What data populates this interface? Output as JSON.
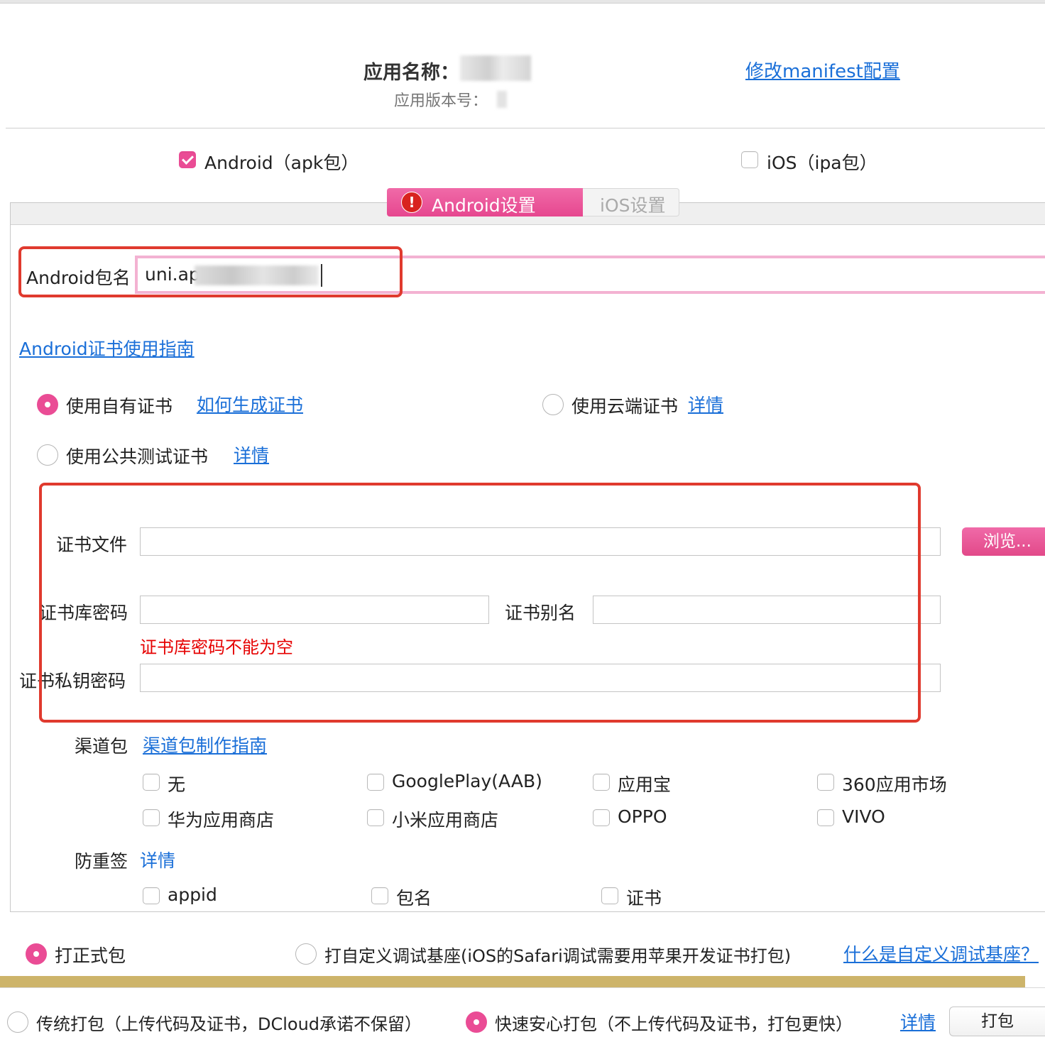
{
  "header": {
    "app_name_label": "应用名称：",
    "version_label": "应用版本号：",
    "manifest_link": "修改manifest配置"
  },
  "platforms": {
    "android": {
      "label": "Android（apk包）",
      "checked": true
    },
    "ios": {
      "label": "iOS（ipa包）",
      "checked": false
    }
  },
  "tabs": [
    {
      "label": "Android设置",
      "active": true,
      "warning": true
    },
    {
      "label": "iOS设置",
      "active": false
    }
  ],
  "package": {
    "label": "Android包名",
    "value": "uni.ap"
  },
  "cert_guide_link": "Android证书使用指南",
  "cert_options": {
    "own": {
      "label": "使用自有证书",
      "link": "如何生成证书",
      "checked": true
    },
    "cloud": {
      "label": "使用云端证书",
      "link": "详情",
      "checked": false
    },
    "public": {
      "label": "使用公共测试证书",
      "link": "详情",
      "checked": false
    }
  },
  "cert_form": {
    "file_label": "证书文件",
    "file_value": "",
    "browse_button": "浏览...",
    "store_password_label": "证书库密码",
    "store_password_value": "",
    "alias_label": "证书别名",
    "alias_value": "",
    "error_text": "证书库密码不能为空",
    "key_password_label": "证书私钥密码",
    "key_password_value": ""
  },
  "channels": {
    "label": "渠道包",
    "link": "渠道包制作指南",
    "items": [
      {
        "label": "无",
        "checked": false
      },
      {
        "label": "GooglePlay(AAB)",
        "checked": false
      },
      {
        "label": "应用宝",
        "checked": false
      },
      {
        "label": "360应用市场",
        "checked": false
      },
      {
        "label": "华为应用商店",
        "checked": false
      },
      {
        "label": "小米应用商店",
        "checked": false
      },
      {
        "label": "OPPO",
        "checked": false
      },
      {
        "label": "VIVO",
        "checked": false
      }
    ]
  },
  "anti_resign": {
    "label": "防重签",
    "link": "详情",
    "items": [
      {
        "label": "appid",
        "checked": false
      },
      {
        "label": "包名",
        "checked": false
      },
      {
        "label": "证书",
        "checked": false
      }
    ]
  },
  "build_type": {
    "release": {
      "label": "打正式包",
      "checked": true
    },
    "custom_base": {
      "label": "打自定义调试基座(iOS的Safari调试需要用苹果开发证书打包)",
      "checked": false
    },
    "custom_base_link": "什么是自定义调试基座？"
  },
  "build_mode": {
    "traditional": {
      "label": "传统打包（上传代码及证书，DCloud承诺不保留）",
      "checked": false
    },
    "fast": {
      "label": "快速安心打包（不上传代码及证书，打包更快）",
      "checked": true
    },
    "details_link": "详情",
    "build_button": "打包"
  },
  "colors": {
    "accent": "#ea4c95",
    "link": "#1a6fd8",
    "error": "#e60000",
    "annotation": "#e03a2e",
    "progress": "#cdb46a"
  }
}
